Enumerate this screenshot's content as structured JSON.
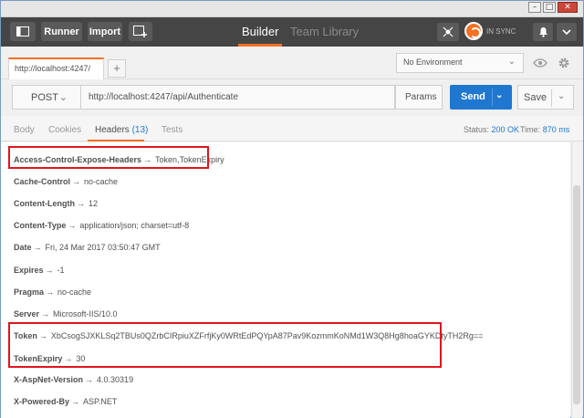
{
  "toolbar": {
    "runner_label": "Runner",
    "import_label": "Import",
    "builder_label": "Builder",
    "team_library_label": "Team Library",
    "sync_status": "IN SYNC"
  },
  "request_tab": {
    "label": "http://localhost:4247/"
  },
  "environment": {
    "selected": "No Environment"
  },
  "request": {
    "method": "POST",
    "url": "http://localhost:4247/api/Authenticate",
    "params_label": "Params",
    "send_label": "Send",
    "save_label": "Save"
  },
  "response": {
    "tabs": {
      "body": "Body",
      "cookies": "Cookies",
      "headers": "Headers",
      "headers_count": "(13)",
      "tests": "Tests"
    },
    "status_label": "Status:",
    "status_value": "200 OK",
    "time_label": "Time:",
    "time_value": "870 ms"
  },
  "headers": [
    {
      "key": "Access-Control-Expose-Headers",
      "value": "Token,TokenExpiry"
    },
    {
      "key": "Cache-Control",
      "value": "no-cache"
    },
    {
      "key": "Content-Length",
      "value": "12"
    },
    {
      "key": "Content-Type",
      "value": "application/json; charset=utf-8"
    },
    {
      "key": "Date",
      "value": "Fri, 24 Mar 2017 03:50:47 GMT"
    },
    {
      "key": "Expires",
      "value": "-1"
    },
    {
      "key": "Pragma",
      "value": "no-cache"
    },
    {
      "key": "Server",
      "value": "Microsoft-IIS/10.0"
    },
    {
      "key": "Token",
      "value": "XbCsogSJXKLSq2TBUs0QZrbCIRpiuXZFrfjKy0WRtEdPQYpA87Pav9KozmmKoNMd1W3Q8Hg8hoaGYKDtyTH2Rg=="
    },
    {
      "key": "TokenExpiry",
      "value": "30"
    },
    {
      "key": "X-AspNet-Version",
      "value": "4.0.30319"
    },
    {
      "key": "X-Powered-By",
      "value": "ASP.NET"
    }
  ],
  "arrow_glyph": "→",
  "colors": {
    "accent": "#f47023",
    "send": "#1f77d0",
    "highlight": "#e0141c",
    "toolbar": "#454545"
  }
}
